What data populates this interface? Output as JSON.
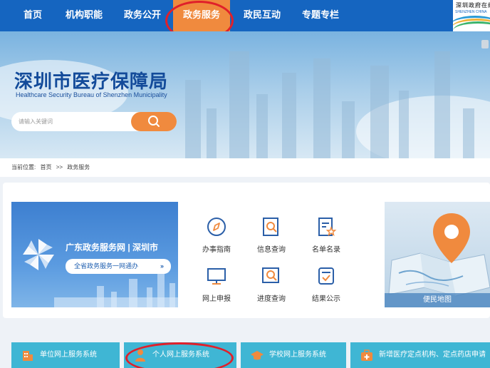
{
  "nav": {
    "items": [
      {
        "label": "首页"
      },
      {
        "label": "机构职能"
      },
      {
        "label": "政务公开"
      },
      {
        "label": "政务服务"
      },
      {
        "label": "政民互动"
      },
      {
        "label": "专题专栏"
      }
    ],
    "active_index": 3,
    "logo_text": "深圳政府在线",
    "logo_sub": "SHENZHEN CHINA",
    "colors": {
      "bar": "#1565c0",
      "active": "#f08a3e",
      "highlight_circle": "#e0202a"
    }
  },
  "banner": {
    "title": "深圳市医疗保障局",
    "subtitle": "Healthcare Security Bureau of Shenzhen Municipality",
    "search_placeholder": "请输入关键词",
    "search_icon": "search-icon"
  },
  "breadcrumb": {
    "prefix": "当前位置:",
    "items": [
      "首页",
      ">>",
      "政务服务"
    ]
  },
  "gd_banner": {
    "title": "广东政务服务网 | 深圳市",
    "button": "全省政务服务一网通办",
    "button_arrow": "»"
  },
  "services": [
    {
      "label": "办事指南",
      "icon": "compass-icon"
    },
    {
      "label": "信息查询",
      "icon": "document-search-icon"
    },
    {
      "label": "名单名录",
      "icon": "list-star-icon"
    },
    {
      "label": "网上申报",
      "icon": "monitor-icon"
    },
    {
      "label": "进度查询",
      "icon": "progress-search-icon"
    },
    {
      "label": "结果公示",
      "icon": "result-check-icon"
    }
  ],
  "map": {
    "label": "便民地图",
    "icon": "map-pin-icon"
  },
  "systems": [
    {
      "label": "单位网上服务系统",
      "icon": "building-icon"
    },
    {
      "label": "个人网上服务系统",
      "icon": "person-icon"
    },
    {
      "label": "学校网上服务系统",
      "icon": "graduation-cap-icon"
    },
    {
      "label": "新增医疗定点机构、定点药店申请",
      "icon": "medical-kit-icon"
    }
  ],
  "colors": {
    "system_tile": "#3fb6d4",
    "accent": "#f08a3e",
    "title_blue": "#134b9a"
  }
}
